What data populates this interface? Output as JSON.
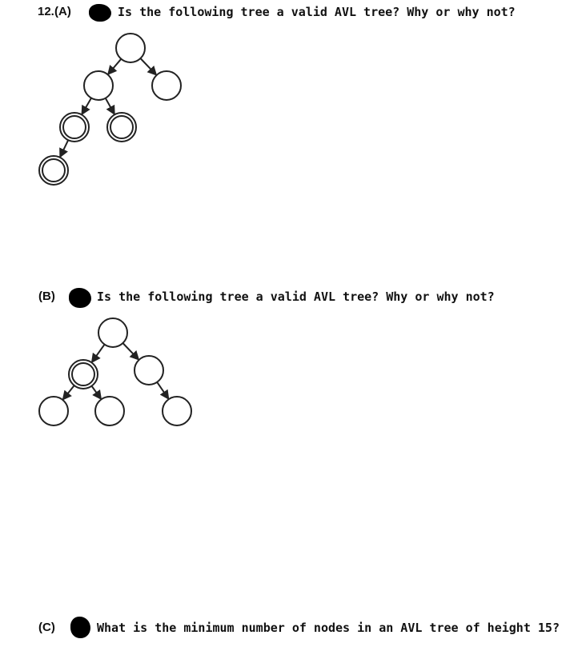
{
  "question_number": "12.",
  "parts": [
    {
      "label": "(A)",
      "question": "Is the following tree a valid AVL tree? Why or why not?",
      "tree": {
        "nodes": [
          {
            "id": "root",
            "double": false
          },
          {
            "id": "L",
            "double": false
          },
          {
            "id": "R",
            "double": false
          },
          {
            "id": "LL",
            "double": true
          },
          {
            "id": "LR",
            "double": true
          },
          {
            "id": "LLL",
            "double": true
          }
        ],
        "edges": [
          [
            "root",
            "L"
          ],
          [
            "root",
            "R"
          ],
          [
            "L",
            "LL"
          ],
          [
            "L",
            "LR"
          ],
          [
            "LL",
            "LLL"
          ]
        ]
      }
    },
    {
      "label": "(B)",
      "question": "Is the following tree a valid AVL tree? Why or why not?",
      "tree": {
        "nodes": [
          {
            "id": "root",
            "double": false
          },
          {
            "id": "L",
            "double": true
          },
          {
            "id": "R",
            "double": false
          },
          {
            "id": "LL",
            "double": false
          },
          {
            "id": "LR",
            "double": false
          },
          {
            "id": "RR",
            "double": false
          }
        ],
        "edges": [
          [
            "root",
            "L"
          ],
          [
            "root",
            "R"
          ],
          [
            "L",
            "LL"
          ],
          [
            "L",
            "LR"
          ],
          [
            "R",
            "RR"
          ]
        ]
      }
    },
    {
      "label": "(C)",
      "question": "What is the minimum number of nodes in an AVL tree of height 15?"
    }
  ]
}
